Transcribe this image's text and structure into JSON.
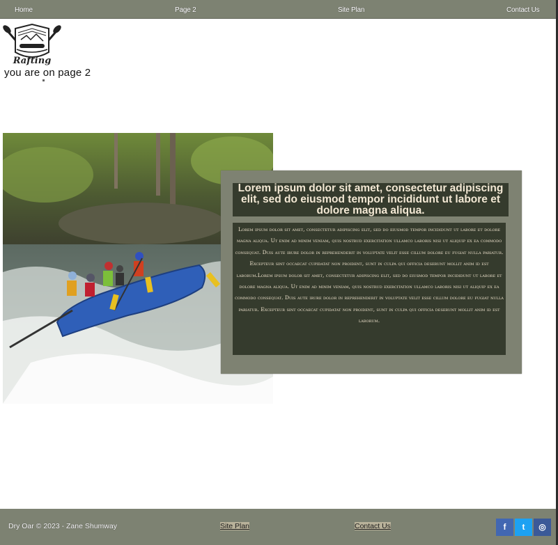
{
  "nav": {
    "home": "Home",
    "page2": "Page 2",
    "site_plan": "Site Plan",
    "contact": "Contact Us"
  },
  "logo": {
    "text": "Rafting"
  },
  "page_indicator": "you are on page 2",
  "card": {
    "title": "Lorem ipsum dolor sit amet, consectetur adipiscing elit, sed do eiusmod tempor incididunt ut labore et dolore magna aliqua.",
    "body": "Lorem ipsum dolor sit amet, consectetur adipiscing elit, sed do eiusmod tempor incididunt ut labore et dolore magna aliqua. Ut enim ad minim veniam, quis nostrud exercitation ullamco laboris nisi ut aliquip ex ea commodo consequat. Duis aute irure dolor in reprehenderit in voluptate velit esse cillum dolore eu fugiat nulla pariatur. Excepteur sint occaecat cupidatat non proident, sunt in culpa qui officia deserunt mollit anim id est laborum.Lorem ipsum dolor sit amet, consectetur adipiscing elit, sed do eiusmod tempor incididunt ut labore et dolore magna aliqua. Ut enim ad minim veniam, quis nostrud exercitation ullamco laboris nisi ut aliquip ex ea commodo consequat. Duis aute irure dolor in reprehenderit in voluptate velit esse cillum dolore eu fugiat nulla pariatur. Excepteur sint occaecat cupidatat non proident, sunt in culpa qui officia deserunt mollit anim id est laborum."
  },
  "footer": {
    "copyright": "Dry Oar © 2023 - Zane Shumway",
    "site_plan": "Site Plan",
    "contact": "Contact Us"
  },
  "social": [
    {
      "name": "facebook-icon",
      "glyph": "f",
      "color": "#4267b2"
    },
    {
      "name": "twitter-icon",
      "glyph": "t",
      "color": "#1da1f2"
    },
    {
      "name": "instagram-icon",
      "glyph": "◎",
      "color": "#3b5998"
    }
  ],
  "colors": {
    "nav_bg": "#7d8272",
    "card_bg": "#7e8272",
    "card_inner": "#353b2d",
    "card_text": "#efe3cd"
  }
}
